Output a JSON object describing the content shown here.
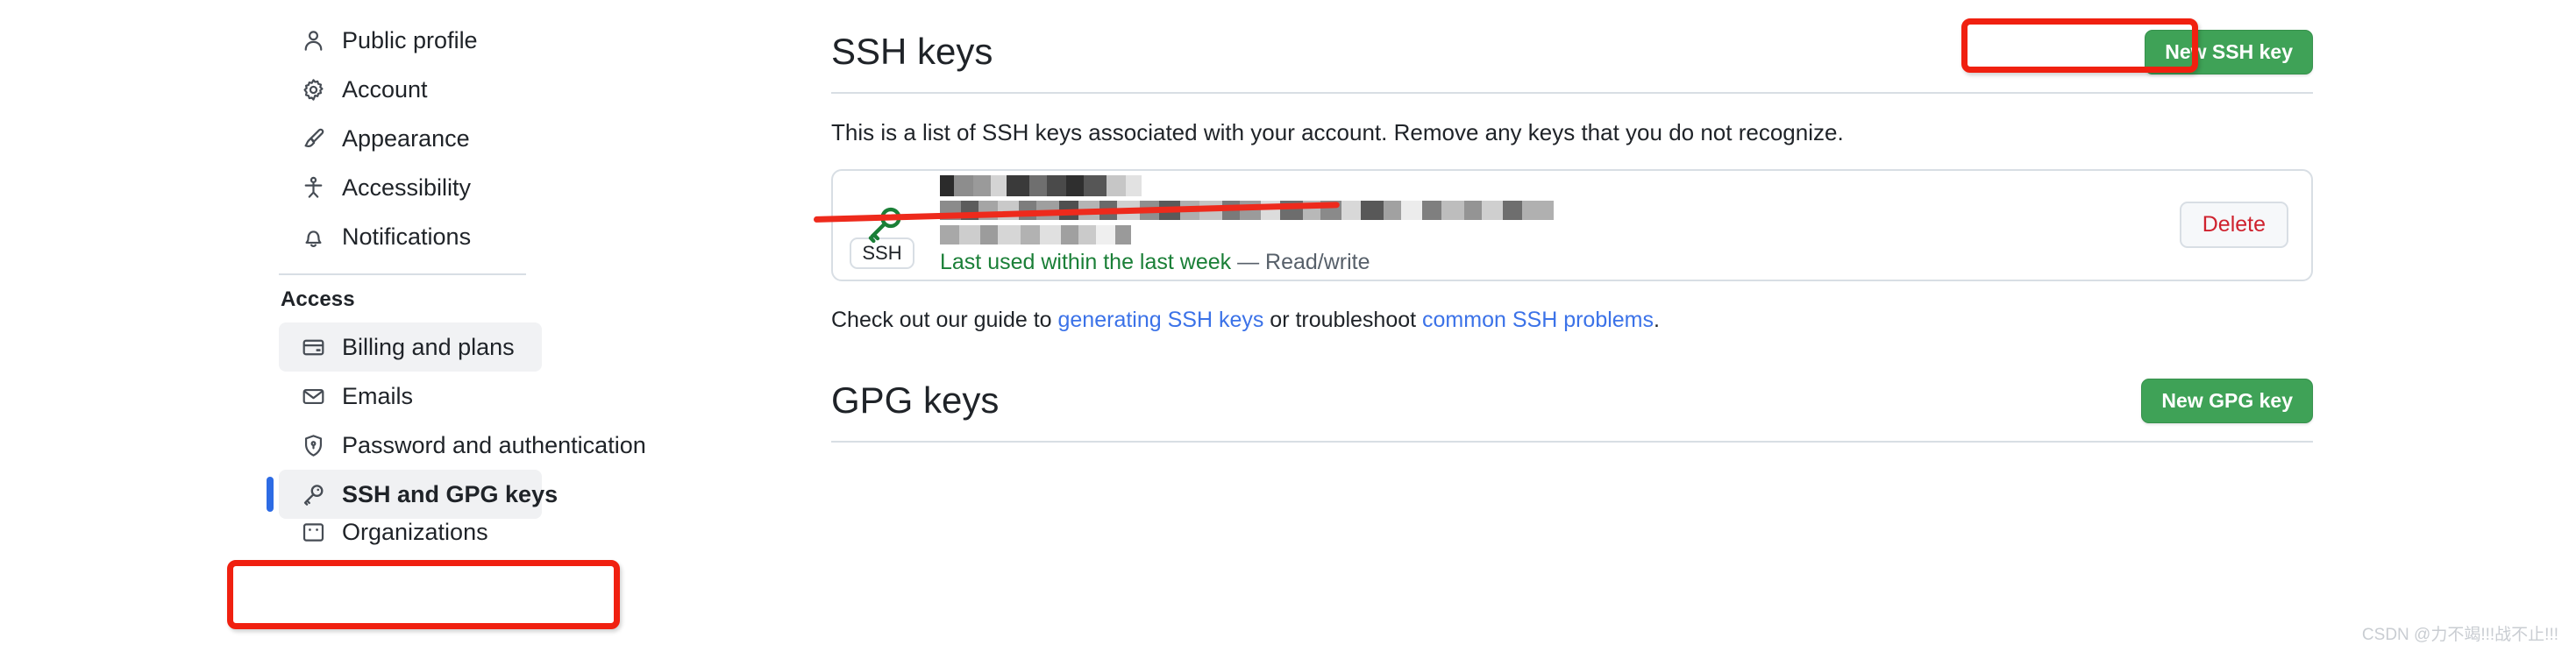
{
  "sidebar": {
    "primary_items": [
      {
        "label": "Public profile",
        "icon": "person-icon",
        "state": "default"
      },
      {
        "label": "Account",
        "icon": "gear-icon",
        "state": "default"
      },
      {
        "label": "Appearance",
        "icon": "paintbrush-icon",
        "state": "default"
      },
      {
        "label": "Accessibility",
        "icon": "accessibility-icon",
        "state": "default"
      },
      {
        "label": "Notifications",
        "icon": "bell-icon",
        "state": "default"
      }
    ],
    "section_label": "Access",
    "access_items": [
      {
        "label": "Billing and plans",
        "icon": "credit-card-icon",
        "state": "hovered"
      },
      {
        "label": "Emails",
        "icon": "mail-icon",
        "state": "default"
      },
      {
        "label": "Password and authentication",
        "icon": "shield-lock-icon",
        "state": "default"
      },
      {
        "label": "SSH and GPG keys",
        "icon": "key-icon",
        "state": "selected"
      },
      {
        "label": "Organizations",
        "icon": "organization-icon",
        "state": "partial"
      }
    ]
  },
  "ssh_section": {
    "title": "SSH keys",
    "new_key_button": "New SSH key",
    "description": "This is a list of SSH keys associated with your account. Remove any keys that you do not recognize.",
    "key_card": {
      "badge": "SSH",
      "title_redacted": "m▒▒ ▒s▒ke▒",
      "fingerprint_redacted": "▒▒▒▒ ▒▒R▒T2▒▒J9▒▒▒Q▒▒▒▒▒▒▒ f▒KI▒ko ▒▒▒vZ▒KF▒MV+▒▒",
      "added_date_redacted": "A▒▒▒▒ ▒▒▒▒▒▒▒, ▒▒22",
      "last_used": "Last used within the last week",
      "access_level": "— Read/write",
      "delete_button": "Delete"
    },
    "guide_prefix": "Check out our guide to ",
    "guide_link_1": "generating SSH keys",
    "guide_middle": " or troubleshoot ",
    "guide_link_2": "common SSH problems",
    "guide_suffix": "."
  },
  "gpg_section": {
    "title": "GPG keys",
    "new_key_button": "New GPG key"
  },
  "annotations": {
    "new_ssh_key_highlight": "red-box",
    "sidebar_ssh_highlight": "red-box",
    "key_strikethrough": "red-line"
  },
  "watermark": "CSDN @力不竭!!!战不止!!!",
  "colors": {
    "green_button": "#3fa257",
    "link_blue": "#3b72e8",
    "annotation_red": "#f02010",
    "active_indicator_blue": "#2d6be4",
    "success_green": "#1a7f37",
    "delete_red": "#cf222e"
  }
}
